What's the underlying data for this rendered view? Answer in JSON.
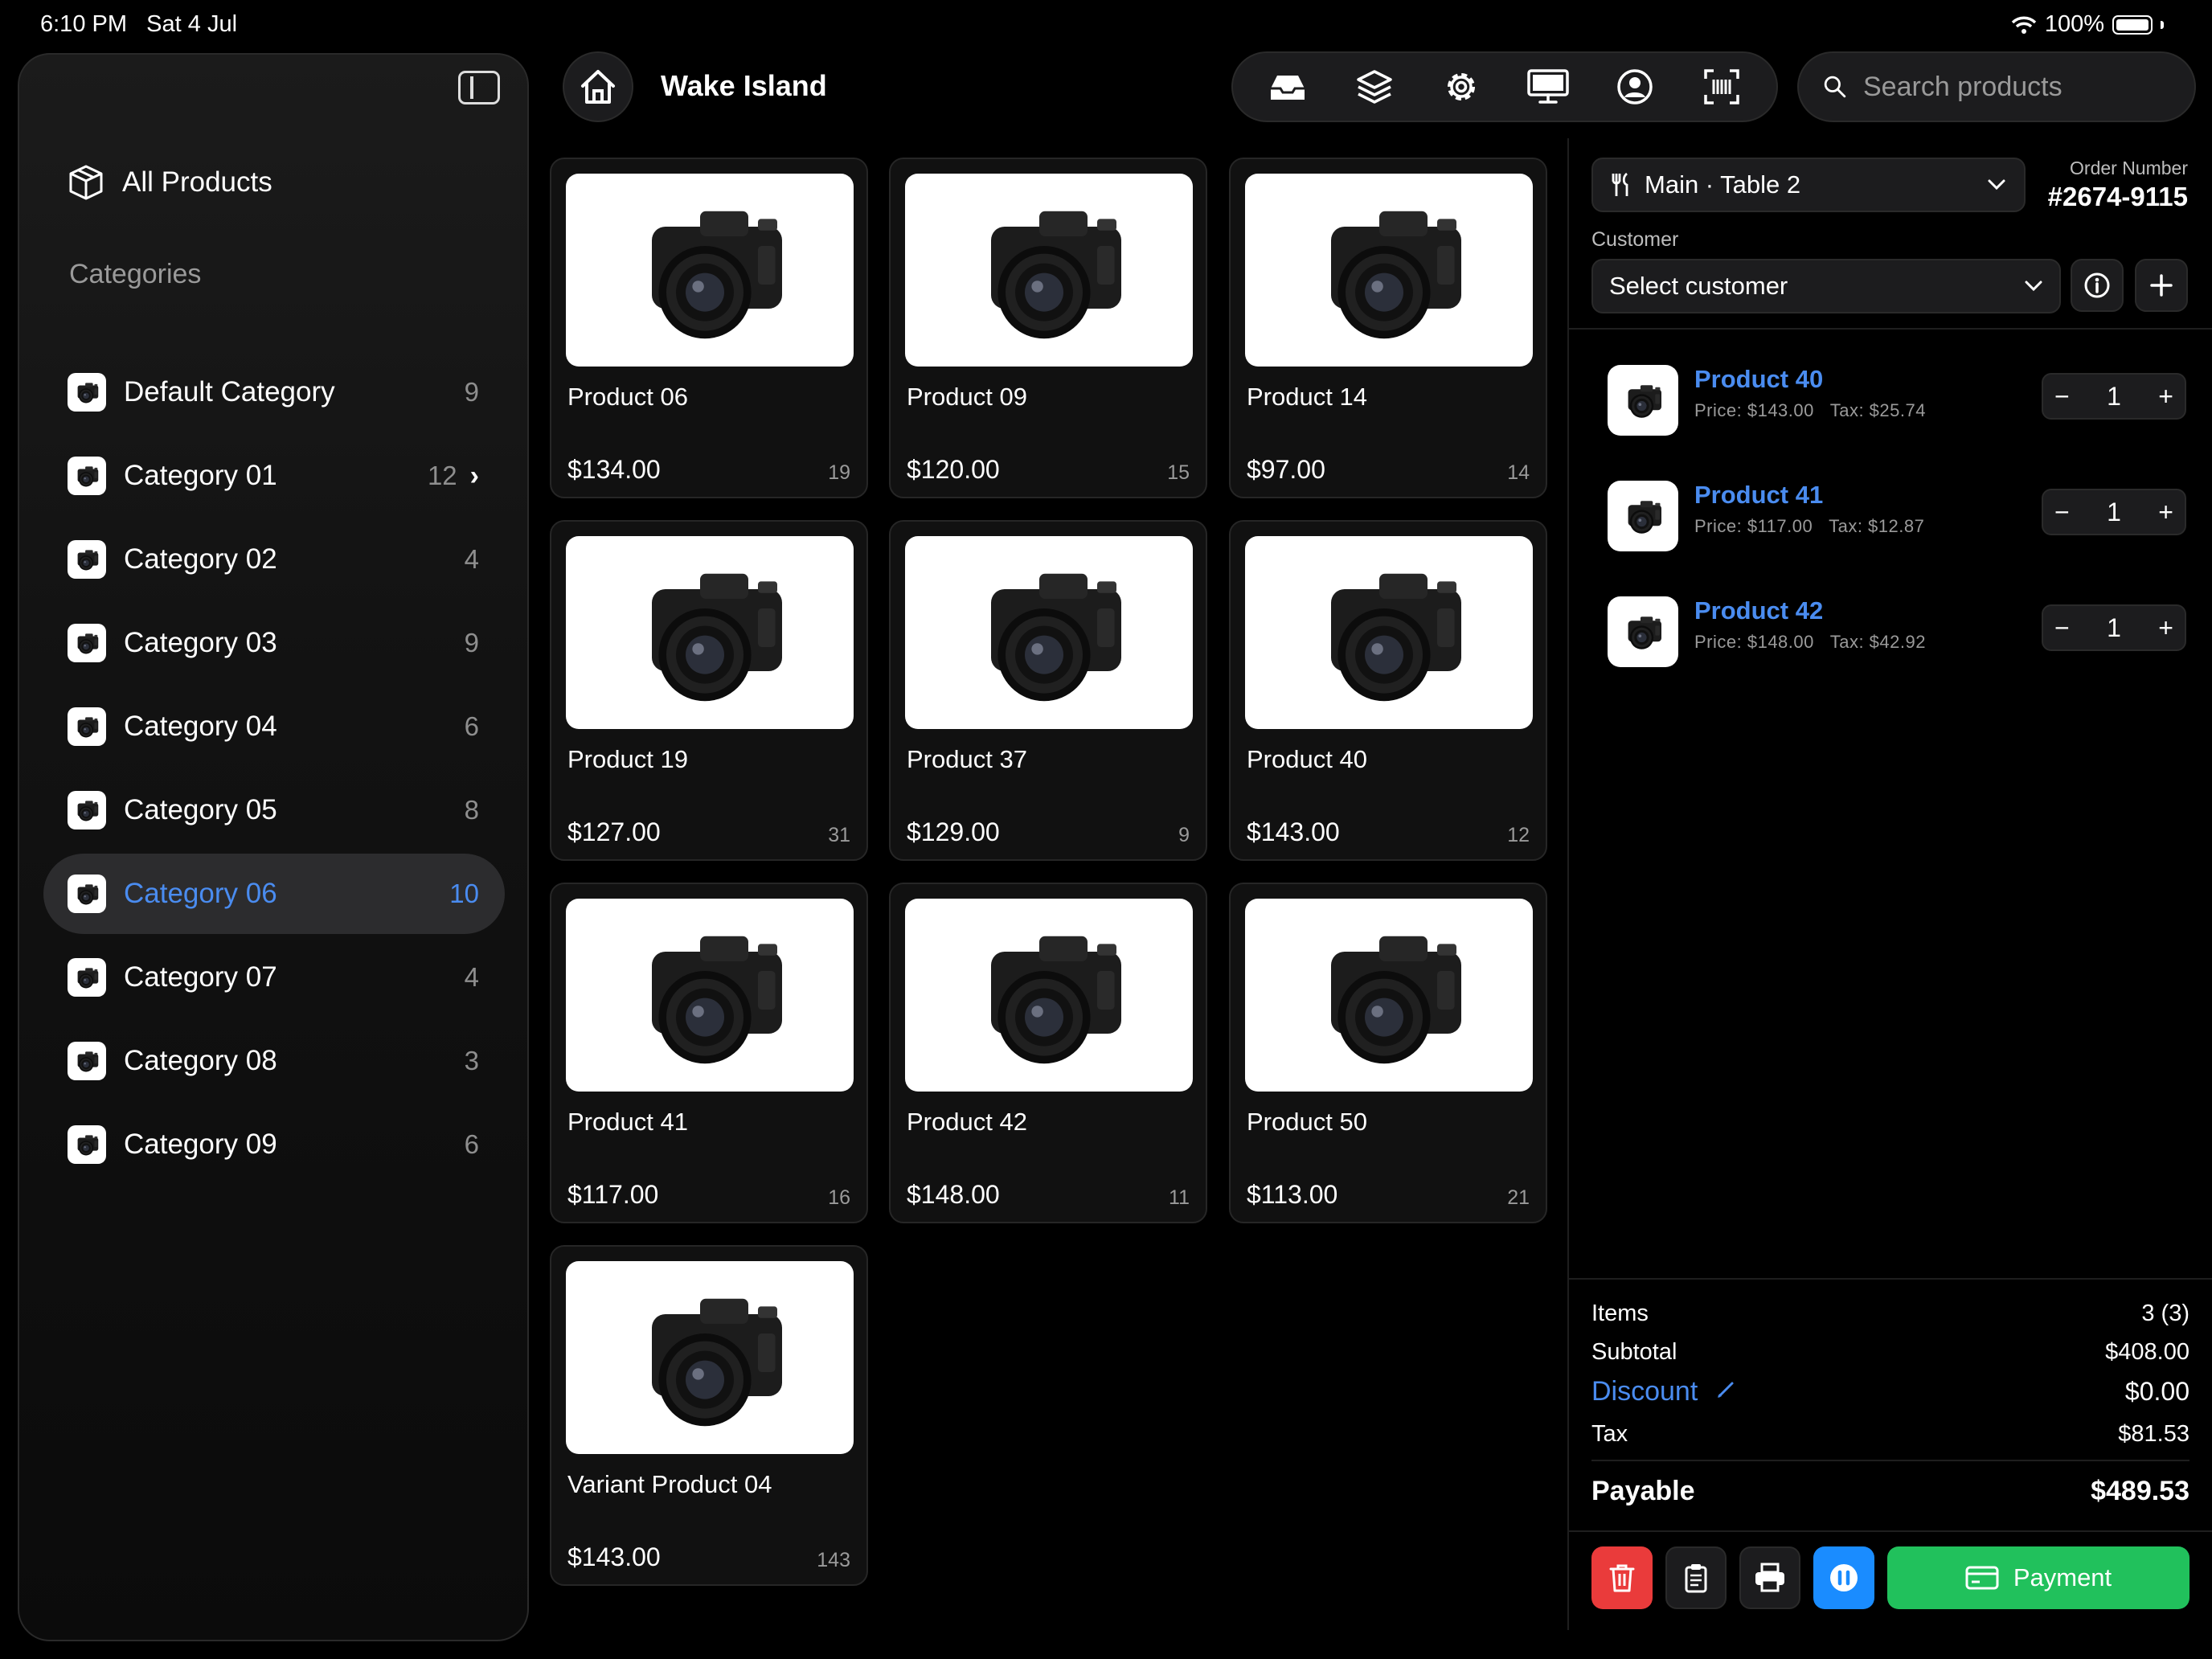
{
  "status": {
    "time": "6:10 PM",
    "date": "Sat 4 Jul",
    "battery": "100%"
  },
  "sidebar": {
    "all_products": "All Products",
    "categories_label": "Categories",
    "categories": [
      {
        "name": "Default Category",
        "count": "9"
      },
      {
        "name": "Category 01",
        "count": "12"
      },
      {
        "name": "Category 02",
        "count": "4"
      },
      {
        "name": "Category 03",
        "count": "9"
      },
      {
        "name": "Category 04",
        "count": "6"
      },
      {
        "name": "Category 05",
        "count": "8"
      },
      {
        "name": "Category 06",
        "count": "10"
      },
      {
        "name": "Category 07",
        "count": "4"
      },
      {
        "name": "Category 08",
        "count": "3"
      },
      {
        "name": "Category 09",
        "count": "6"
      }
    ]
  },
  "header": {
    "location": "Wake Island",
    "toolbar_icons": [
      "inbox-icon",
      "layers-icon",
      "gear-icon",
      "monitor-icon",
      "user-icon",
      "barcode-scan-icon"
    ],
    "search_placeholder": "Search products"
  },
  "products": [
    {
      "name": "Product 06",
      "price": "$134.00",
      "stock": "19"
    },
    {
      "name": "Product 09",
      "price": "$120.00",
      "stock": "15"
    },
    {
      "name": "Product 14",
      "price": "$97.00",
      "stock": "14"
    },
    {
      "name": "Product 19",
      "price": "$127.00",
      "stock": "31"
    },
    {
      "name": "Product 37",
      "price": "$129.00",
      "stock": "9"
    },
    {
      "name": "Product 40",
      "price": "$143.00",
      "stock": "12"
    },
    {
      "name": "Product 41",
      "price": "$117.00",
      "stock": "16"
    },
    {
      "name": "Product 42",
      "price": "$148.00",
      "stock": "11"
    },
    {
      "name": "Product 50",
      "price": "$113.00",
      "stock": "21"
    },
    {
      "name": "Variant Product 04",
      "price": "$143.00",
      "stock": "143"
    }
  ],
  "order": {
    "table": "Main · Table 2",
    "order_number_label": "Order Number",
    "order_number": "#2674-9115",
    "customer_label": "Customer",
    "customer_value": "Select customer",
    "lines": [
      {
        "name": "Product 40",
        "price": "Price: $143.00",
        "tax": "Tax: $25.74",
        "qty": "1"
      },
      {
        "name": "Product 41",
        "price": "Price: $117.00",
        "tax": "Tax: $12.87",
        "qty": "1"
      },
      {
        "name": "Product 42",
        "price": "Price: $148.00",
        "tax": "Tax: $42.92",
        "qty": "1"
      }
    ],
    "summary": {
      "items_label": "Items",
      "items_value": "3 (3)",
      "subtotal_label": "Subtotal",
      "subtotal_value": "$408.00",
      "discount_label": "Discount",
      "discount_value": "$0.00",
      "tax_label": "Tax",
      "tax_value": "$81.53",
      "payable_label": "Payable",
      "payable_value": "$489.53"
    },
    "payment_label": "Payment"
  },
  "colors": {
    "accent": "#4a8cf0",
    "delete": "#ea3b3b",
    "hold": "#1a8cff",
    "pay": "#21c15c"
  }
}
